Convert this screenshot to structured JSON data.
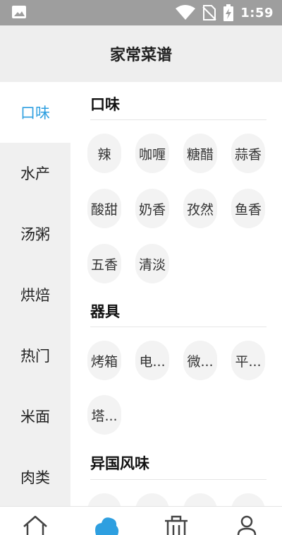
{
  "status_bar": {
    "time": "1:59",
    "icons": [
      "image-icon",
      "wifi-icon",
      "no-sim-icon",
      "battery-charging-icon"
    ]
  },
  "header": {
    "title": "家常菜谱"
  },
  "sidebar": {
    "items": [
      {
        "label": "口味",
        "active": true
      },
      {
        "label": "水产",
        "active": false
      },
      {
        "label": "汤粥",
        "active": false
      },
      {
        "label": "烘焙",
        "active": false
      },
      {
        "label": "热门",
        "active": false
      },
      {
        "label": "米面",
        "active": false
      },
      {
        "label": "肉类",
        "active": false
      }
    ]
  },
  "sections": [
    {
      "title": "口味",
      "tags": [
        "辣",
        "咖喱",
        "糖醋",
        "蒜香",
        "酸甜",
        "奶香",
        "孜然",
        "鱼香",
        "五香",
        "清淡"
      ]
    },
    {
      "title": "器具",
      "tags": [
        "烤箱",
        "电...",
        "微...",
        "平...",
        "塔..."
      ]
    },
    {
      "title": "异国风味",
      "tags": []
    }
  ],
  "bottom_nav": {
    "items": [
      {
        "icon": "home-icon",
        "active": false
      },
      {
        "icon": "cloud-icon",
        "active": true
      },
      {
        "icon": "trash-icon",
        "active": false
      },
      {
        "icon": "profile-icon",
        "active": false
      }
    ],
    "active_color": "#2e9fe0"
  },
  "colors": {
    "accent": "#2e9fe0",
    "status_bar": "#9e9e9e",
    "header_bg": "#eeeeee",
    "sidebar_bg": "#f0f0f0",
    "tag_bg": "#f3f3f3"
  }
}
